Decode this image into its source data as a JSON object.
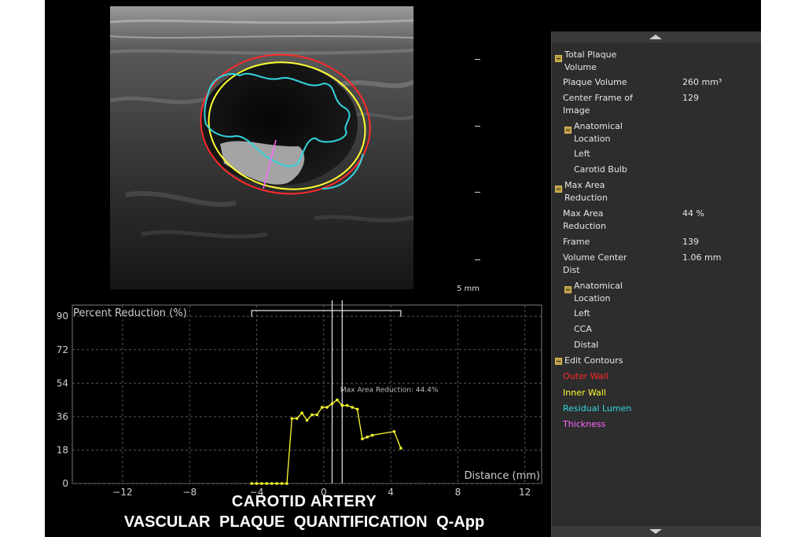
{
  "scale": {
    "label": "5 mm"
  },
  "chart_data": {
    "type": "line",
    "ylabel": "Percent Reduction (%)",
    "xlabel": "Distance (mm)",
    "xlim": [
      -15,
      13
    ],
    "ylim": [
      0,
      96
    ],
    "xticks": [
      -12,
      -8,
      -4,
      0,
      4,
      8,
      12
    ],
    "yticks": [
      0,
      18,
      36,
      54,
      72,
      90
    ],
    "x": [
      -4.3,
      -4.0,
      -3.7,
      -3.4,
      -3.1,
      -2.8,
      -2.5,
      -2.2,
      -1.9,
      -1.6,
      -1.3,
      -1.0,
      -0.7,
      -0.4,
      -0.1,
      0.2,
      0.5,
      0.8,
      1.1,
      1.4,
      1.7,
      2.0,
      2.3,
      2.6,
      2.9,
      4.2,
      4.6
    ],
    "values": [
      0,
      0,
      0,
      0,
      0,
      0,
      0,
      0,
      35,
      35,
      38,
      34,
      37,
      37,
      41,
      41,
      43,
      45,
      42,
      42,
      41,
      40,
      24,
      25,
      26,
      28,
      19
    ],
    "annotation": "Max Area Reduction: 44.4%",
    "cursor_lines_x": [
      0.5,
      1.1
    ],
    "bracket_x": [
      -4.3,
      4.6
    ],
    "grid": true
  },
  "titles": {
    "line1": "CAROTID  ARTERY",
    "line2": "VASCULAR  PLAQUE  QUANTIFICATION  Q-App"
  },
  "panel": {
    "total_plaque_volume": "Total Plaque Volume",
    "plaque_volume_label": "Plaque Volume",
    "plaque_volume_value": "260 mm³",
    "center_frame_label": "Center Frame of Image",
    "center_frame_value": "129",
    "anatomical_location_1": "Anatomical Location",
    "loc1_side": "Left",
    "loc1_site": "Carotid Bulb",
    "max_area_reduction_header": "Max Area Reduction",
    "max_area_reduction_label": "Max Area Reduction",
    "max_area_reduction_value": "44 %",
    "frame_label": "Frame",
    "frame_value": "139",
    "volume_center_dist_label": "Volume Center Dist",
    "volume_center_dist_value": "1.06 mm",
    "anatomical_location_2": "Anatomical Location",
    "loc2_side": "Left",
    "loc2_site": "CCA",
    "loc2_pos": "Distal",
    "edit_contours": "Edit Contours",
    "contours": {
      "outer_wall": "Outer Wall",
      "inner_wall": "Inner Wall",
      "residual_lumen": "Residual Lumen",
      "thickness": "Thickness"
    },
    "colors": {
      "outer_wall": "#ff2a2a",
      "inner_wall": "#ffff33",
      "residual_lumen": "#33d6e0",
      "thickness": "#ff66ff"
    }
  }
}
